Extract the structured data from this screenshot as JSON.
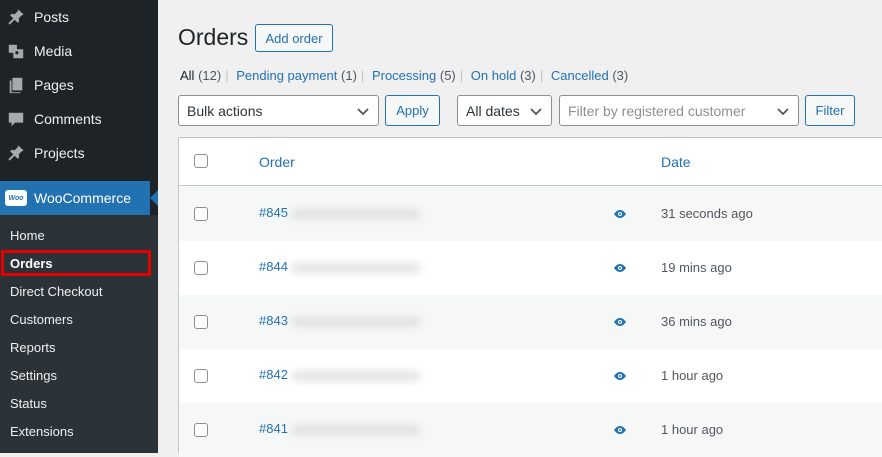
{
  "sidebar": {
    "items": [
      {
        "label": "Posts",
        "icon": "pin-icon"
      },
      {
        "label": "Media",
        "icon": "media-icon"
      },
      {
        "label": "Pages",
        "icon": "pages-icon"
      },
      {
        "label": "Comments",
        "icon": "comment-icon"
      },
      {
        "label": "Projects",
        "icon": "pin-icon"
      }
    ],
    "woocommerce": {
      "label": "WooCommerce",
      "logo_text": "Woo"
    },
    "submenu": [
      {
        "label": "Home"
      },
      {
        "label": "Orders",
        "current": true
      },
      {
        "label": "Direct Checkout"
      },
      {
        "label": "Customers"
      },
      {
        "label": "Reports"
      },
      {
        "label": "Settings"
      },
      {
        "label": "Status"
      },
      {
        "label": "Extensions"
      }
    ]
  },
  "header": {
    "title": "Orders",
    "add_button": "Add order"
  },
  "status_filters": [
    {
      "label": "All",
      "count": "(12)",
      "current": true
    },
    {
      "label": "Pending payment",
      "count": "(1)"
    },
    {
      "label": "Processing",
      "count": "(5)"
    },
    {
      "label": "On hold",
      "count": "(3)"
    },
    {
      "label": "Cancelled",
      "count": "(3)"
    }
  ],
  "filters": {
    "bulk_actions": "Bulk actions",
    "apply": "Apply",
    "dates": "All dates",
    "customer_placeholder": "Filter by registered customer",
    "filter_button": "Filter"
  },
  "table": {
    "columns": {
      "order": "Order",
      "date": "Date"
    },
    "rows": [
      {
        "order": "#845",
        "date": "31 seconds ago"
      },
      {
        "order": "#844",
        "date": "19 mins ago"
      },
      {
        "order": "#843",
        "date": "36 mins ago"
      },
      {
        "order": "#842",
        "date": "1 hour ago"
      },
      {
        "order": "#841",
        "date": "1 hour ago"
      }
    ]
  },
  "colors": {
    "accent": "#2271b1",
    "sidebar_bg": "#1d2327",
    "submenu_bg": "#2c3338",
    "highlight_box": "#e60000"
  }
}
